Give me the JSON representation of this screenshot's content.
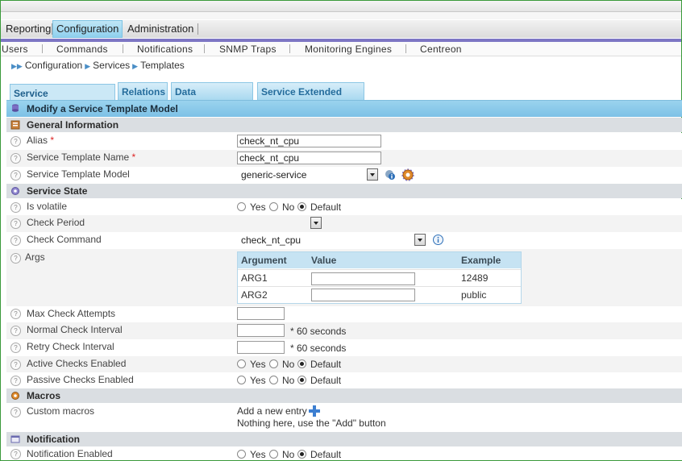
{
  "main_menu": {
    "items": [
      "Reporting",
      "Configuration",
      "Administration"
    ],
    "active": "Configuration"
  },
  "sub_menu": [
    "Users",
    "Commands",
    "Notifications",
    "SNMP Traps",
    "Monitoring Engines",
    "Centreon"
  ],
  "breadcrumb": [
    "Configuration",
    "Services",
    "Templates"
  ],
  "tabs": [
    "Service Configuration",
    "Relations",
    "Data Processing",
    "Service Extended Info"
  ],
  "form": {
    "title": "Modify a Service Template Model",
    "sections": {
      "general": "General Information",
      "state": "Service State",
      "macros": "Macros",
      "notification": "Notification"
    },
    "alias": {
      "label": "Alias",
      "required": "*",
      "value": "check_nt_cpu"
    },
    "template_name": {
      "label": "Service Template Name",
      "required": "*",
      "value": "check_nt_cpu"
    },
    "template_model": {
      "label": "Service Template Model",
      "value": "generic-service"
    },
    "is_volatile": {
      "label": "Is volatile"
    },
    "check_period": {
      "label": "Check Period",
      "value": ""
    },
    "check_command": {
      "label": "Check Command",
      "value": "check_nt_cpu"
    },
    "args": {
      "label": "Args",
      "headers": [
        "Argument",
        "Value",
        "Example"
      ],
      "rows": [
        {
          "argument": "ARG1",
          "value": "",
          "example": "12489"
        },
        {
          "argument": "ARG2",
          "value": "",
          "example": "public"
        }
      ]
    },
    "max_check_attempts": {
      "label": "Max Check Attempts",
      "value": ""
    },
    "normal_check_interval": {
      "label": "Normal Check Interval",
      "value": "",
      "suffix": "* 60 seconds"
    },
    "retry_check_interval": {
      "label": "Retry Check Interval",
      "value": "",
      "suffix": "* 60 seconds"
    },
    "active_checks": {
      "label": "Active Checks Enabled"
    },
    "passive_checks": {
      "label": "Passive Checks Enabled"
    },
    "custom_macros": {
      "label": "Custom macros",
      "add_text": "Add a new entry",
      "empty_text": "Nothing here, use the \"Add\" button"
    },
    "notification_enabled": {
      "label": "Notification Enabled"
    },
    "radio_options": {
      "yes": "Yes",
      "no": "No",
      "default": "Default"
    },
    "selected_option": "Default"
  },
  "icons": [
    "help-icon",
    "template-icon",
    "info-icon",
    "gear-icon",
    "plus-icon",
    "database-icon",
    "notification-icon"
  ]
}
